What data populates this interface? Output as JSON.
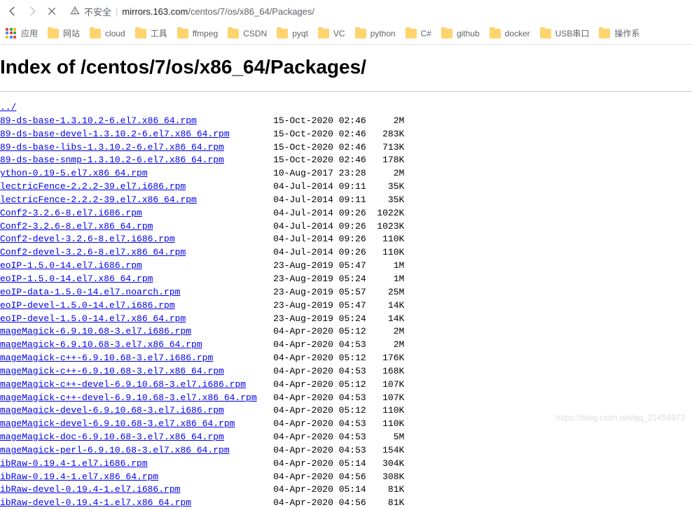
{
  "toolbar": {
    "insecure_label": "不安全",
    "url_host": "mirrors.163.com",
    "url_path": "/centos/7/os/x86_64/Packages/"
  },
  "bookmarks": {
    "apps_label": "应用",
    "apps_colors": [
      "#ea4335",
      "#34a853",
      "#fbbc05",
      "#4285f4",
      "#ea4335",
      "#34a853",
      "#fbbc05",
      "#4285f4",
      "#ea4335"
    ],
    "items": [
      "网站",
      "cloud",
      "工具",
      "ffmpeg",
      "CSDN",
      "pyqt",
      "VC",
      "python",
      "C#",
      "github",
      "docker",
      "USB串口",
      "操作系"
    ]
  },
  "page": {
    "title": "Index of /centos/7/os/x86_64/Packages/",
    "parent_link": "../"
  },
  "files": [
    {
      "name": "89-ds-base-1.3.10.2-6.el7.x86_64.rpm",
      "date": "15-Oct-2020 02:46",
      "size": "2M"
    },
    {
      "name": "89-ds-base-devel-1.3.10.2-6.el7.x86_64.rpm",
      "date": "15-Oct-2020 02:46",
      "size": "283K"
    },
    {
      "name": "89-ds-base-libs-1.3.10.2-6.el7.x86_64.rpm",
      "date": "15-Oct-2020 02:46",
      "size": "713K"
    },
    {
      "name": "89-ds-base-snmp-1.3.10.2-6.el7.x86_64.rpm",
      "date": "15-Oct-2020 02:46",
      "size": "178K"
    },
    {
      "name": "ython-0.19-5.el7.x86_64.rpm",
      "date": "10-Aug-2017 23:28",
      "size": "2M"
    },
    {
      "name": "lectricFence-2.2.2-39.el7.i686.rpm",
      "date": "04-Jul-2014 09:11",
      "size": "35K"
    },
    {
      "name": "lectricFence-2.2.2-39.el7.x86_64.rpm",
      "date": "04-Jul-2014 09:11",
      "size": "35K"
    },
    {
      "name": "Conf2-3.2.6-8.el7.i686.rpm",
      "date": "04-Jul-2014 09:26",
      "size": "1022K"
    },
    {
      "name": "Conf2-3.2.6-8.el7.x86_64.rpm",
      "date": "04-Jul-2014 09:26",
      "size": "1023K"
    },
    {
      "name": "Conf2-devel-3.2.6-8.el7.i686.rpm",
      "date": "04-Jul-2014 09:26",
      "size": "110K"
    },
    {
      "name": "Conf2-devel-3.2.6-8.el7.x86_64.rpm",
      "date": "04-Jul-2014 09:26",
      "size": "110K"
    },
    {
      "name": "eoIP-1.5.0-14.el7.i686.rpm",
      "date": "23-Aug-2019 05:47",
      "size": "1M"
    },
    {
      "name": "eoIP-1.5.0-14.el7.x86_64.rpm",
      "date": "23-Aug-2019 05:24",
      "size": "1M"
    },
    {
      "name": "eoIP-data-1.5.0-14.el7.noarch.rpm",
      "date": "23-Aug-2019 05:57",
      "size": "25M"
    },
    {
      "name": "eoIP-devel-1.5.0-14.el7.i686.rpm",
      "date": "23-Aug-2019 05:47",
      "size": "14K"
    },
    {
      "name": "eoIP-devel-1.5.0-14.el7.x86_64.rpm",
      "date": "23-Aug-2019 05:24",
      "size": "14K"
    },
    {
      "name": "mageMagick-6.9.10.68-3.el7.i686.rpm",
      "date": "04-Apr-2020 05:12",
      "size": "2M"
    },
    {
      "name": "mageMagick-6.9.10.68-3.el7.x86_64.rpm",
      "date": "04-Apr-2020 04:53",
      "size": "2M"
    },
    {
      "name": "mageMagick-c++-6.9.10.68-3.el7.i686.rpm",
      "date": "04-Apr-2020 05:12",
      "size": "176K"
    },
    {
      "name": "mageMagick-c++-6.9.10.68-3.el7.x86_64.rpm",
      "date": "04-Apr-2020 04:53",
      "size": "168K"
    },
    {
      "name": "mageMagick-c++-devel-6.9.10.68-3.el7.i686.rpm",
      "date": "04-Apr-2020 05:12",
      "size": "107K"
    },
    {
      "name": "mageMagick-c++-devel-6.9.10.68-3.el7.x86_64.rpm",
      "date": "04-Apr-2020 04:53",
      "size": "107K"
    },
    {
      "name": "mageMagick-devel-6.9.10.68-3.el7.i686.rpm",
      "date": "04-Apr-2020 05:12",
      "size": "110K"
    },
    {
      "name": "mageMagick-devel-6.9.10.68-3.el7.x86_64.rpm",
      "date": "04-Apr-2020 04:53",
      "size": "110K"
    },
    {
      "name": "mageMagick-doc-6.9.10.68-3.el7.x86_64.rpm",
      "date": "04-Apr-2020 04:53",
      "size": "5M"
    },
    {
      "name": "mageMagick-perl-6.9.10.68-3.el7.x86_64.rpm",
      "date": "04-Apr-2020 04:53",
      "size": "154K"
    },
    {
      "name": "ibRaw-0.19.4-1.el7.i686.rpm",
      "date": "04-Apr-2020 05:14",
      "size": "304K"
    },
    {
      "name": "ibRaw-0.19.4-1.el7.x86_64.rpm",
      "date": "04-Apr-2020 04:56",
      "size": "308K"
    },
    {
      "name": "ibRaw-devel-0.19.4-1.el7.i686.rpm",
      "date": "04-Apr-2020 05:14",
      "size": "81K"
    },
    {
      "name": "ibRaw-devel-0.19.4-1.el7.x86_64.rpm",
      "date": "04-Apr-2020 04:56",
      "size": "81K"
    }
  ],
  "watermark": "https://blog.csdn.net/qq_21454973"
}
